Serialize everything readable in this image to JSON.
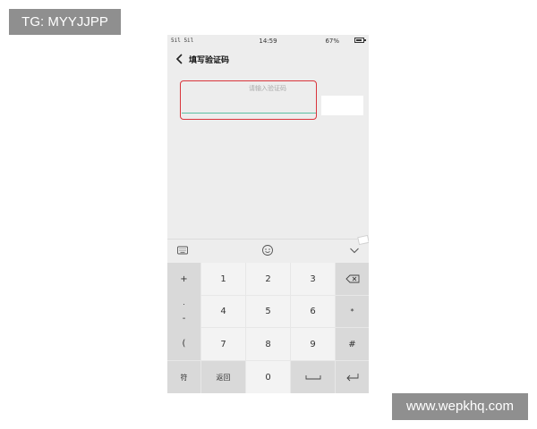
{
  "watermarks": {
    "top_left": "TG: MYYJJPP",
    "bottom_right": "www.wepkhq.com"
  },
  "status_bar": {
    "signal": "5il 5il",
    "time": "14:59",
    "battery": "67%"
  },
  "header": {
    "title": "填写验证码",
    "back_icon": "chevron-left-icon"
  },
  "form": {
    "code_placeholder": "请输入验证码",
    "code_value": ""
  },
  "highlight_color": "#d9343b",
  "accent_color": "#5bbfa3",
  "toolbar": {
    "left_icon": "keyboard-icon",
    "center_icon": "emoji-icon",
    "right_icon": "chevron-down-icon"
  },
  "keyboard": {
    "left_column": [
      "+",
      ".",
      "-",
      "("
    ],
    "rows": [
      [
        "1",
        "2",
        "3"
      ],
      [
        "4",
        "5",
        "6"
      ],
      [
        "7",
        "8",
        "9"
      ]
    ],
    "right_column": [
      "backspace",
      "*",
      "#"
    ],
    "bottom": {
      "symbols": "符",
      "back": "返回",
      "zero": "0",
      "space": "space",
      "enter": "enter"
    }
  }
}
